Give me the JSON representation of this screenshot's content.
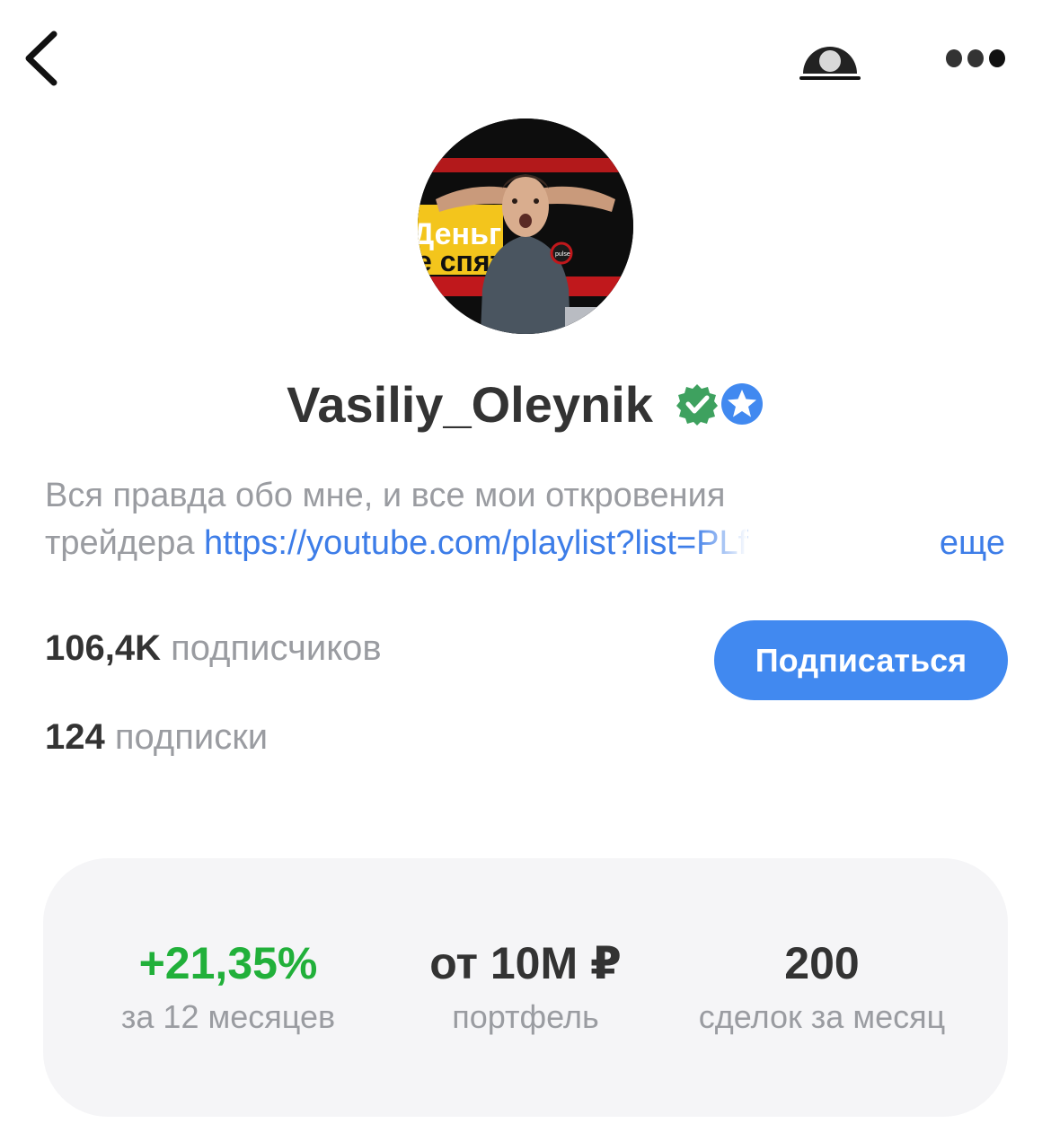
{
  "header": {
    "back_icon": "chevron-left-icon",
    "camera_icon": "camera-icon",
    "more_icon": "more-dots-icon"
  },
  "profile": {
    "username": "Vasiliy_Oleynik",
    "avatar_text_line1": "Деньг",
    "avatar_text_line2": "е спят",
    "avatar_badge_text": "pulse",
    "badges": [
      "verified-green-badge-icon",
      "star-blue-badge-icon"
    ],
    "colors": {
      "verified": "#3ea15f",
      "star_badge": "#4189f0",
      "link": "#3d7de8",
      "accent_button": "#4189f0",
      "positive": "#21b03a"
    }
  },
  "bio": {
    "line1": "Вся правда обо мне, и все мои откровения",
    "line2_prefix": "трейдера ",
    "link": "https://youtube.com/playlist?list=PLf",
    "more": "еще"
  },
  "stats": {
    "followers_count": "106,4K",
    "followers_label": " подписчиков",
    "following_count": "124",
    "following_label": " подписки"
  },
  "subscribe_button": "Подписаться",
  "metrics": [
    {
      "value": "+21,35%",
      "label": "за 12 месяцев"
    },
    {
      "value": "от 10M ₽",
      "label": "портфель"
    },
    {
      "value": "200",
      "label": "сделок за месяц"
    }
  ]
}
